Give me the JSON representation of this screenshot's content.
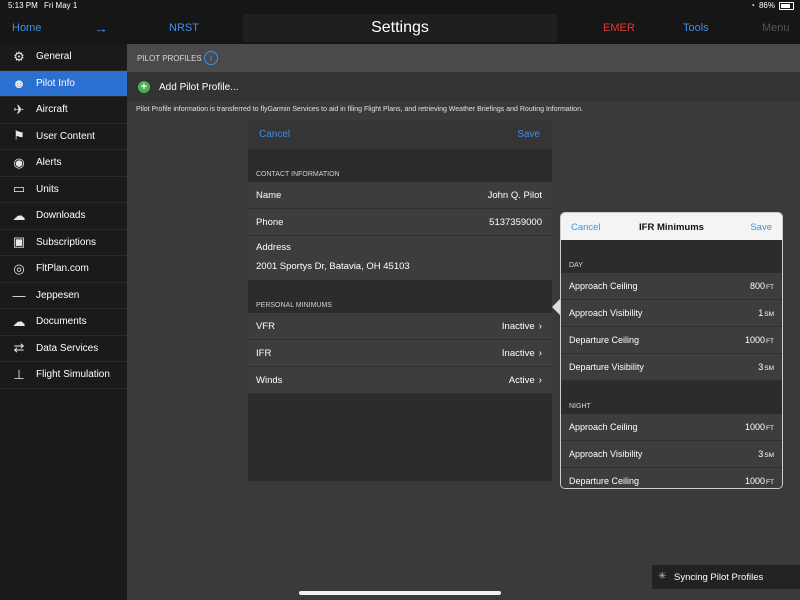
{
  "status_bar": {
    "time": "5:13 PM",
    "date": "Fri May 1",
    "battery": "86%"
  },
  "navbar": {
    "home": "Home",
    "nrst": "NRST",
    "title": "Settings",
    "emer": "EMER",
    "tools": "Tools",
    "menu": "Menu"
  },
  "sidebar": {
    "items": [
      {
        "label": "General",
        "icon": "gear-icon"
      },
      {
        "label": "Pilot Info",
        "icon": "pilot-icon"
      },
      {
        "label": "Aircraft",
        "icon": "plane-icon"
      },
      {
        "label": "User Content",
        "icon": "flag-icon"
      },
      {
        "label": "Alerts",
        "icon": "alerts-icon"
      },
      {
        "label": "Units",
        "icon": "ruler-icon"
      },
      {
        "label": "Downloads",
        "icon": "cloud-download-icon"
      },
      {
        "label": "Subscriptions",
        "icon": "lock-icon"
      },
      {
        "label": "FltPlan.com",
        "icon": "fltplan-icon"
      },
      {
        "label": "Jeppesen",
        "icon": "jeppesen-icon"
      },
      {
        "label": "Documents",
        "icon": "cloud-icon"
      },
      {
        "label": "Data Services",
        "icon": "data-services-icon"
      },
      {
        "label": "Flight Simulation",
        "icon": "joystick-icon"
      }
    ],
    "active_index": 1
  },
  "main": {
    "section_label": "PILOT PROFILES",
    "add_profile": "Add Pilot Profile...",
    "note": "Pilot Profile information is transferred to flyGarmin Services to aid in filing Flight Plans, and retrieving Weather Briefings and Routing Information."
  },
  "profile_sheet": {
    "cancel": "Cancel",
    "save": "Save",
    "contact_header": "CONTACT INFORMATION",
    "name_label": "Name",
    "name_value": "John Q. Pilot",
    "phone_label": "Phone",
    "phone_value": "5137359000",
    "address_label": "Address",
    "address_value": "2001 Sportys Dr, Batavia, OH 45103",
    "minimums_header": "PERSONAL MINIMUMS",
    "minimums": [
      {
        "label": "VFR",
        "value": "Inactive"
      },
      {
        "label": "IFR",
        "value": "Inactive"
      },
      {
        "label": "Winds",
        "value": "Active"
      }
    ]
  },
  "ifr_popover": {
    "cancel": "Cancel",
    "title": "IFR Minimums",
    "save": "Save",
    "day_header": "DAY",
    "day": [
      {
        "label": "Approach Ceiling",
        "value": "800",
        "unit": "FT"
      },
      {
        "label": "Approach Visibility",
        "value": "1",
        "unit": "SM"
      },
      {
        "label": "Departure Ceiling",
        "value": "1000",
        "unit": "FT"
      },
      {
        "label": "Departure Visibility",
        "value": "3",
        "unit": "SM"
      }
    ],
    "night_header": "NIGHT",
    "night": [
      {
        "label": "Approach Ceiling",
        "value": "1000",
        "unit": "FT"
      },
      {
        "label": "Approach Visibility",
        "value": "3",
        "unit": "SM"
      },
      {
        "label": "Departure Ceiling",
        "value": "1000",
        "unit": "FT"
      }
    ]
  },
  "sync": {
    "text": "Syncing Pilot Profiles"
  }
}
